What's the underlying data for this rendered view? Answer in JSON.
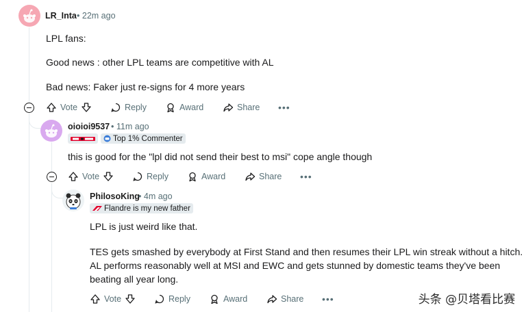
{
  "comments": [
    {
      "username": "LR_Inta",
      "separator": "•",
      "time": "22m ago",
      "lines": [
        "LPL fans:",
        "Good news : other LPL teams are competitive with AL",
        "Bad news: Faker just re-signs for 4 more years"
      ]
    },
    {
      "username": "oioioi9537",
      "separator": "•",
      "time": "11m ago",
      "flair_logo": "T1",
      "flair_text": "Top 1% Commenter",
      "lines": [
        "this is good for the \"lpl did not send their best to msi\" cope angle though"
      ]
    },
    {
      "username": "PhilosoKing",
      "separator": "•",
      "time": "4m ago",
      "flair_text": "Flandre is my new father",
      "lines": [
        "LPL is just weird like that.",
        "TES gets smashed by everybody at First Stand and then resumes their LPL win streak without a hitch.",
        "AL performs reasonably well at MSI and EWC and gets stunned by domestic teams they've been",
        "beating all year long."
      ]
    }
  ],
  "actions": {
    "vote": "Vote",
    "reply": "Reply",
    "award": "Award",
    "share": "Share",
    "more": "•••"
  },
  "watermark": "头条 @贝塔看比赛",
  "icons": [
    "reddit-avatar-icon",
    "collapse-icon",
    "upvote-icon",
    "downvote-icon",
    "reply-icon",
    "award-icon",
    "share-icon",
    "more-icon",
    "t1-logo-icon",
    "top-commenter-icon"
  ],
  "colors": {
    "meta": "#576f76",
    "text": "#1a1a1b",
    "flair_bg": "#e5ebee",
    "avatar1": "#f6a7b3",
    "avatar2": "#d9a9ef"
  }
}
